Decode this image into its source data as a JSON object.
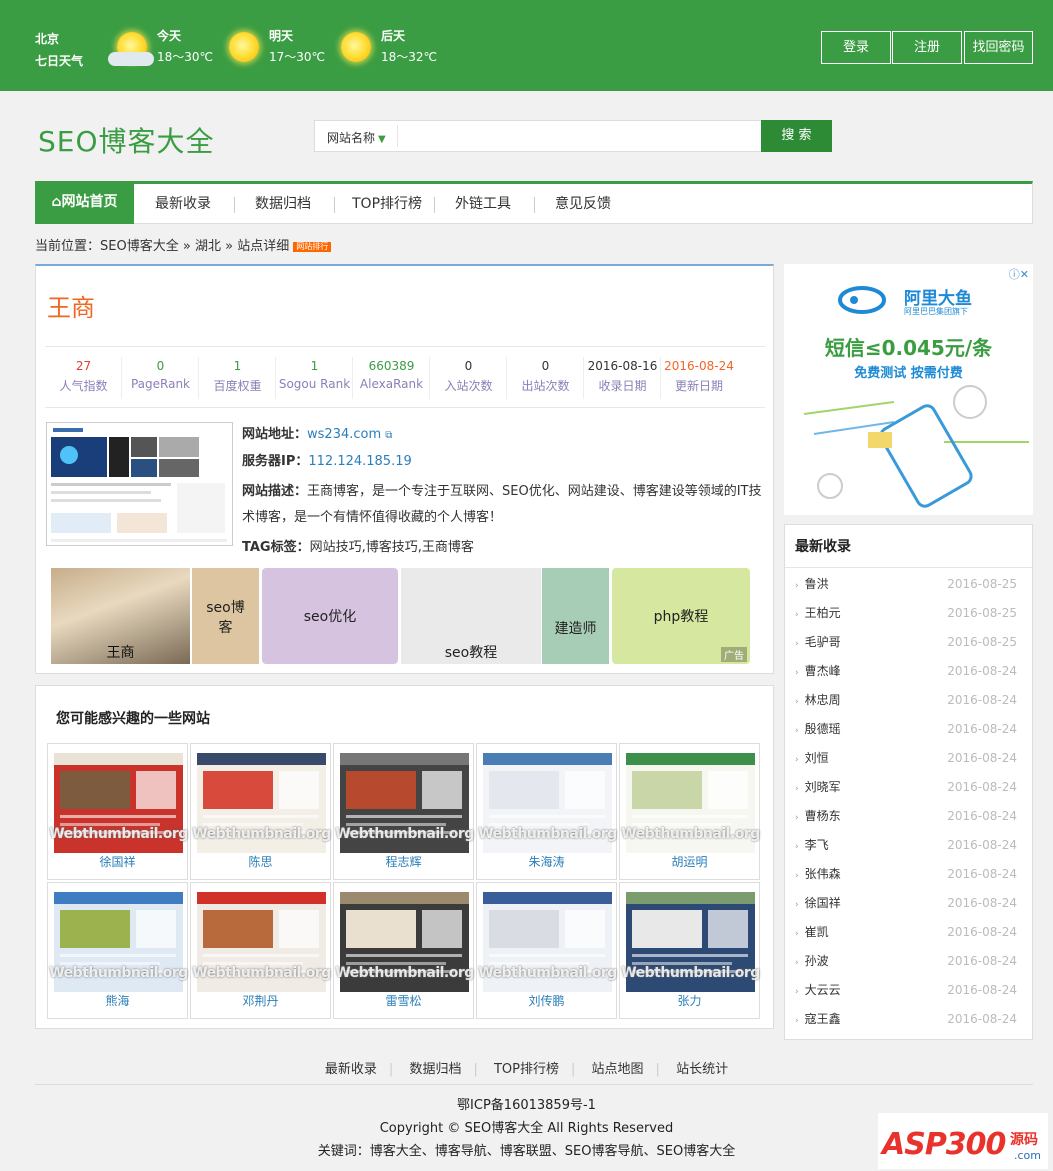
{
  "weather": {
    "city": "北京",
    "subtitle": "七日天气",
    "days": [
      {
        "label": "今天",
        "temp": "18～30℃"
      },
      {
        "label": "明天",
        "temp": "17～30℃"
      },
      {
        "label": "后天",
        "temp": "18～32℃"
      }
    ]
  },
  "top_buttons": {
    "login": "登录",
    "register": "注册",
    "recover": "找回密码"
  },
  "logo": "SEO博客大全",
  "search": {
    "category": "网站名称",
    "placeholder": "",
    "button": "搜 索"
  },
  "nav": {
    "home": "网站首页",
    "items": [
      "最新收录",
      "数据归档",
      "TOP排行榜",
      "外链工具",
      "意见反馈"
    ]
  },
  "breadcrumb": {
    "prefix": "当前位置：",
    "items": [
      "SEO博客大全",
      "湖北",
      "站点详细"
    ],
    "sep": "»",
    "badge": "网站排行"
  },
  "site": {
    "name": "王商",
    "stats": [
      {
        "value": "27",
        "label": "人气指数",
        "color": "#e03c31"
      },
      {
        "value": "0",
        "label": "PageRank",
        "color": "#3b9d43"
      },
      {
        "value": "1",
        "label": "百度权重",
        "color": "#3b9d43"
      },
      {
        "value": "1",
        "label": "Sogou Rank",
        "color": "#3b9d43"
      },
      {
        "value": "660389",
        "label": "AlexaRank",
        "color": "#3b9d43"
      },
      {
        "value": "0",
        "label": "入站次数",
        "color": "#333333"
      },
      {
        "value": "0",
        "label": "出站次数",
        "color": "#333333"
      },
      {
        "value": "2016-08-16",
        "label": "收录日期",
        "color": "#333333"
      },
      {
        "value": "2016-08-24",
        "label": "更新日期",
        "color": "#f26522"
      }
    ],
    "url_label": "网站地址：",
    "url": "ws234.com",
    "ip_label": "服务器IP：",
    "ip": "112.124.185.19",
    "desc_label": "网站描述：",
    "desc": "王商博客，是一个专注于互联网、SEO优化、网站建设、博客建设等领域的IT技术博客，是一个有情怀值得收藏的个人博客！",
    "tag_label": "TAG标签：",
    "tags": "网站技巧,博客技巧,王商博客"
  },
  "ad_tiles": [
    {
      "text": "王商",
      "color": "#d8c2a0"
    },
    {
      "text": "seo博客",
      "color": "#dcc5a0"
    },
    {
      "text": "seo优化",
      "color": "#d6c3e0"
    },
    {
      "text": "seo教程",
      "color": "#e9e9e9"
    },
    {
      "text": "建造师",
      "color": "#a8cdb6"
    },
    {
      "text": "php教程",
      "color": "#d6e79f"
    }
  ],
  "ad_label": "广告",
  "sidebar_ad": {
    "brand": "阿里大鱼",
    "brand_sub": "阿里巴巴集团旗下",
    "headline": "短信≤0.045元/条",
    "sub": "免费测试 按需付费"
  },
  "latest": {
    "title": "最新收录",
    "items": [
      {
        "name": "鲁洪",
        "date": "2016-08-25"
      },
      {
        "name": "王柏元",
        "date": "2016-08-25"
      },
      {
        "name": "毛驴哥",
        "date": "2016-08-25"
      },
      {
        "name": "曹杰峰",
        "date": "2016-08-24"
      },
      {
        "name": "林忠周",
        "date": "2016-08-24"
      },
      {
        "name": "殷德瑶",
        "date": "2016-08-24"
      },
      {
        "name": "刘恒",
        "date": "2016-08-24"
      },
      {
        "name": "刘晓军",
        "date": "2016-08-24"
      },
      {
        "name": "曹杨东",
        "date": "2016-08-24"
      },
      {
        "name": "李飞",
        "date": "2016-08-24"
      },
      {
        "name": "张伟森",
        "date": "2016-08-24"
      },
      {
        "name": "徐国祥",
        "date": "2016-08-24"
      },
      {
        "name": "崔凯",
        "date": "2016-08-24"
      },
      {
        "name": "孙波",
        "date": "2016-08-24"
      },
      {
        "name": "大云云",
        "date": "2016-08-24"
      },
      {
        "name": "寇王鑫",
        "date": "2016-08-24"
      }
    ]
  },
  "related": {
    "title": "您可能感兴趣的一些网站",
    "watermark": "Webthumbnail.org",
    "sites": [
      "徐国祥",
      "陈思",
      "程志辉",
      "朱海涛",
      "胡运明",
      "熊海",
      "邓荆丹",
      "雷雪松",
      "刘传鹏",
      "张力"
    ]
  },
  "footer": {
    "links": [
      "最新收录",
      "数据归档",
      "TOP排行榜",
      "站点地图",
      "站长统计"
    ],
    "icp": "鄂ICP备16013859号-1",
    "copyright": "Copyright © SEO博客大全 All Rights Reserved",
    "keywords": "关键词：博客大全、博客导航、博客联盟、SEO博客导航、SEO博客大全"
  },
  "corner_brand": {
    "text": "ASP300",
    "suffix": "源码",
    "sub": ".com"
  }
}
